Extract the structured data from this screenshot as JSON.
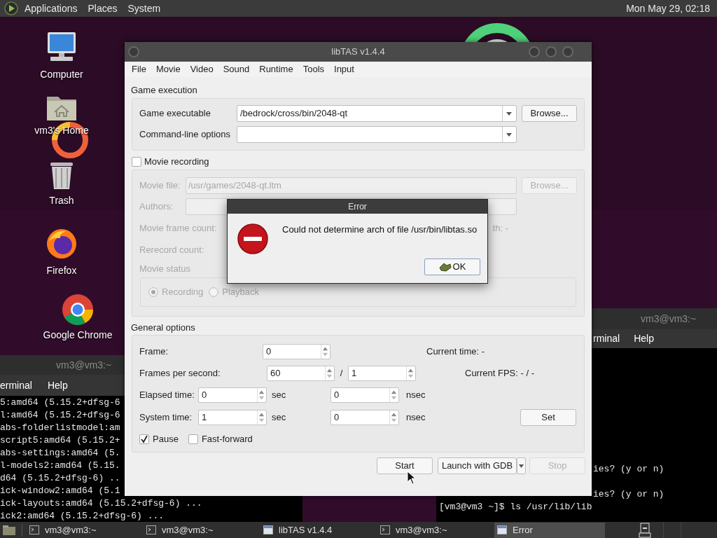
{
  "top_panel": {
    "menus": [
      "Applications",
      "Places",
      "System"
    ],
    "clock": "Mon May 29, 02:18"
  },
  "desktop_icons": [
    {
      "label": "Computer",
      "kind": "computer"
    },
    {
      "label": "vm3's Home",
      "kind": "home"
    },
    {
      "label": "Trash",
      "kind": "trash"
    },
    {
      "label": "Firefox",
      "kind": "firefox"
    },
    {
      "label": "Google Chrome",
      "kind": "chrome"
    }
  ],
  "terminal_left": {
    "title": "vm3@vm3:~",
    "menus": [
      "erminal",
      "Help"
    ],
    "lines": [
      "5:amd64 (5.15.2+dfsg-6",
      "l:amd64 (5.15.2+dfsg-6",
      "abs-folderlistmodel:am",
      "script5:amd64 (5.15.2+",
      "abs-settings:amd64 (5.",
      "l-models2:amd64 (5.15.",
      "d64 (5.15.2+dfsg-6) ..",
      "ick-window2:amd64 (5.1",
      "ick-layouts:amd64 (5.15.2+dfsg-6) ...",
      "ick2:amd64 (5.15.2+dfsg-6) ..."
    ]
  },
  "terminal_right": {
    "title": "vm3@vm3:~",
    "menus": [
      "rminal",
      "Help"
    ],
    "lines": [
      {
        "text": "ies? (y or n)",
        "kind": "clipped"
      },
      {
        "text": "ies? (y or n)",
        "kind": "clipped"
      },
      {
        "text": "[vm3@vm3 ~]$ ls /usr/lib/lib",
        "kind": "full"
      }
    ]
  },
  "libtas": {
    "title": "libTAS v1.4.4",
    "menus": [
      "File",
      "Movie",
      "Video",
      "Sound",
      "Runtime",
      "Tools",
      "Input"
    ],
    "game_execution": {
      "title": "Game execution",
      "executable_label": "Game executable",
      "executable": "/bedrock/cross/bin/2048-qt",
      "options_label": "Command-line options",
      "browse": "Browse..."
    },
    "movie_recording": {
      "label": "Movie recording",
      "checked": false,
      "movie_file_label": "Movie file:",
      "movie_file": "/usr/games/2048-qt.ltm",
      "browse": "Browse...",
      "authors_label": "Authors:",
      "frame_count_label": "Movie frame count:",
      "length_fragment": "th: -",
      "rerecord_label": "Rerecord count:",
      "status_label": "Movie status",
      "status_options": [
        {
          "label": "Recording",
          "selected": true
        },
        {
          "label": "Playback",
          "selected": false
        }
      ]
    },
    "general_options": {
      "title": "General options",
      "frame_label": "Frame:",
      "frame": "0",
      "current_time": "Current time: -",
      "fps_label": "Frames per second:",
      "fps_num": "60",
      "fps_sep": "/",
      "fps_den": "1",
      "current_fps": "Current FPS: - / -",
      "time_rows": [
        {
          "label": "Elapsed time:",
          "sec": "0",
          "sec_unit": "sec",
          "nsec": "0",
          "nsec_unit": "nsec"
        },
        {
          "label": "System time:",
          "sec": "1",
          "sec_unit": "sec",
          "nsec": "0",
          "nsec_unit": "nsec"
        }
      ],
      "set_button": "Set",
      "checkboxes": [
        {
          "label": "Pause",
          "checked": true
        },
        {
          "label": "Fast-forward",
          "checked": false
        }
      ]
    },
    "buttons": {
      "start": "Start",
      "gdb": "Launch with GDB",
      "stop": "Stop",
      "stop_disabled": true
    }
  },
  "error_dialog": {
    "title": "Error",
    "message": "Could not determine arch of file /usr/bin/libtas.so",
    "ok": "OK"
  },
  "taskbar": {
    "items": [
      {
        "label": "vm3@vm3:~",
        "kind": "terminal",
        "selected": false
      },
      {
        "label": "vm3@vm3:~",
        "kind": "terminal",
        "selected": false
      },
      {
        "label": "libTAS v1.4.4",
        "kind": "window",
        "selected": false
      },
      {
        "label": "vm3@vm3:~",
        "kind": "terminal",
        "selected": false
      },
      {
        "label": "Error",
        "kind": "window",
        "selected": true
      }
    ]
  }
}
